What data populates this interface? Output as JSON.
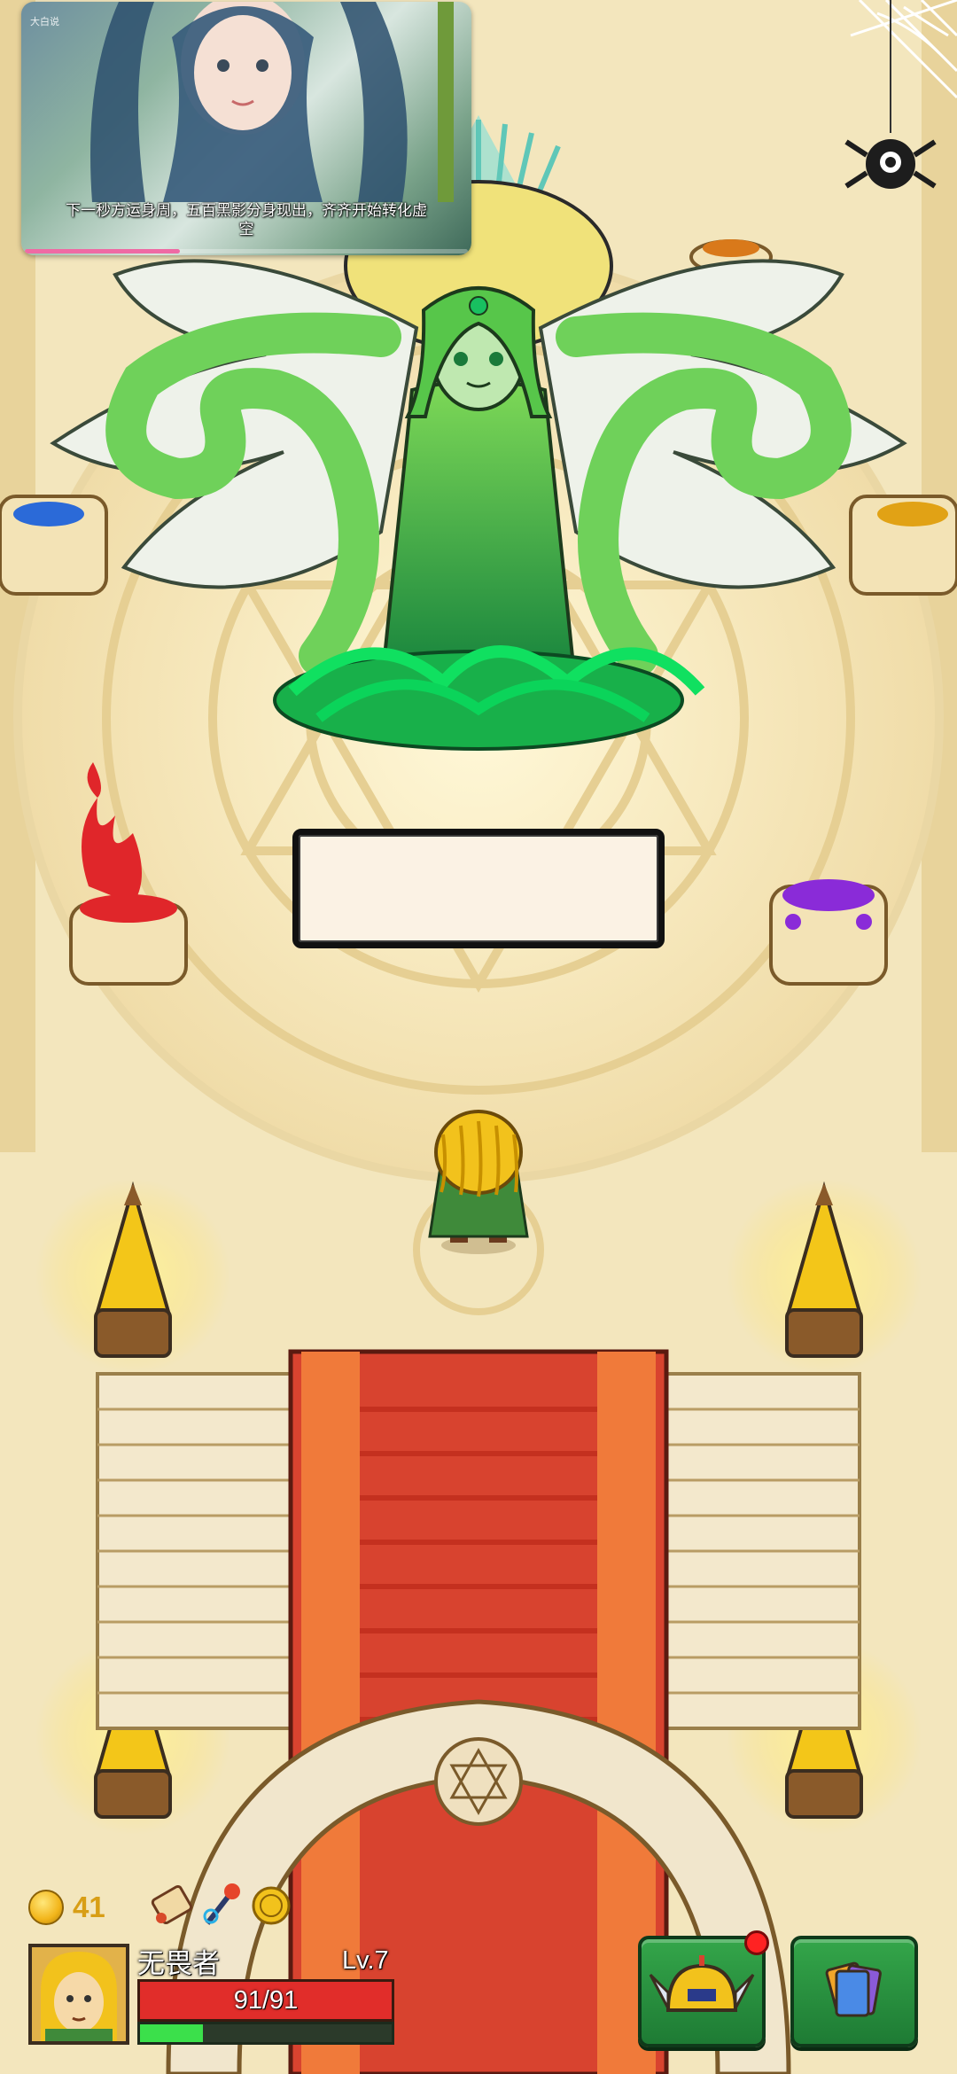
{
  "video_overlay": {
    "corner_tag": "大白说",
    "subtitle": "下一秒方运身周，五百黑影分身现出，齐齐开始转化虚空",
    "progress": 0.35
  },
  "dialog": {
    "text": ""
  },
  "hud": {
    "gold": "41",
    "hero": {
      "name": "无畏者",
      "level": "Lv.7",
      "hp_text": "91/91",
      "hp_fraction": 1.0,
      "xp_fraction": 0.25
    },
    "buffs": [
      "scroll-icon",
      "wand-icon",
      "coin-icon"
    ],
    "buttons": [
      "equipment-helmet-icon",
      "cards-icon"
    ]
  },
  "colors": {
    "hp": "#e12d2a",
    "xp": "#3be04b",
    "gold": "#d89e15",
    "button": "#2c9a44",
    "carpet": "#d8432f"
  }
}
